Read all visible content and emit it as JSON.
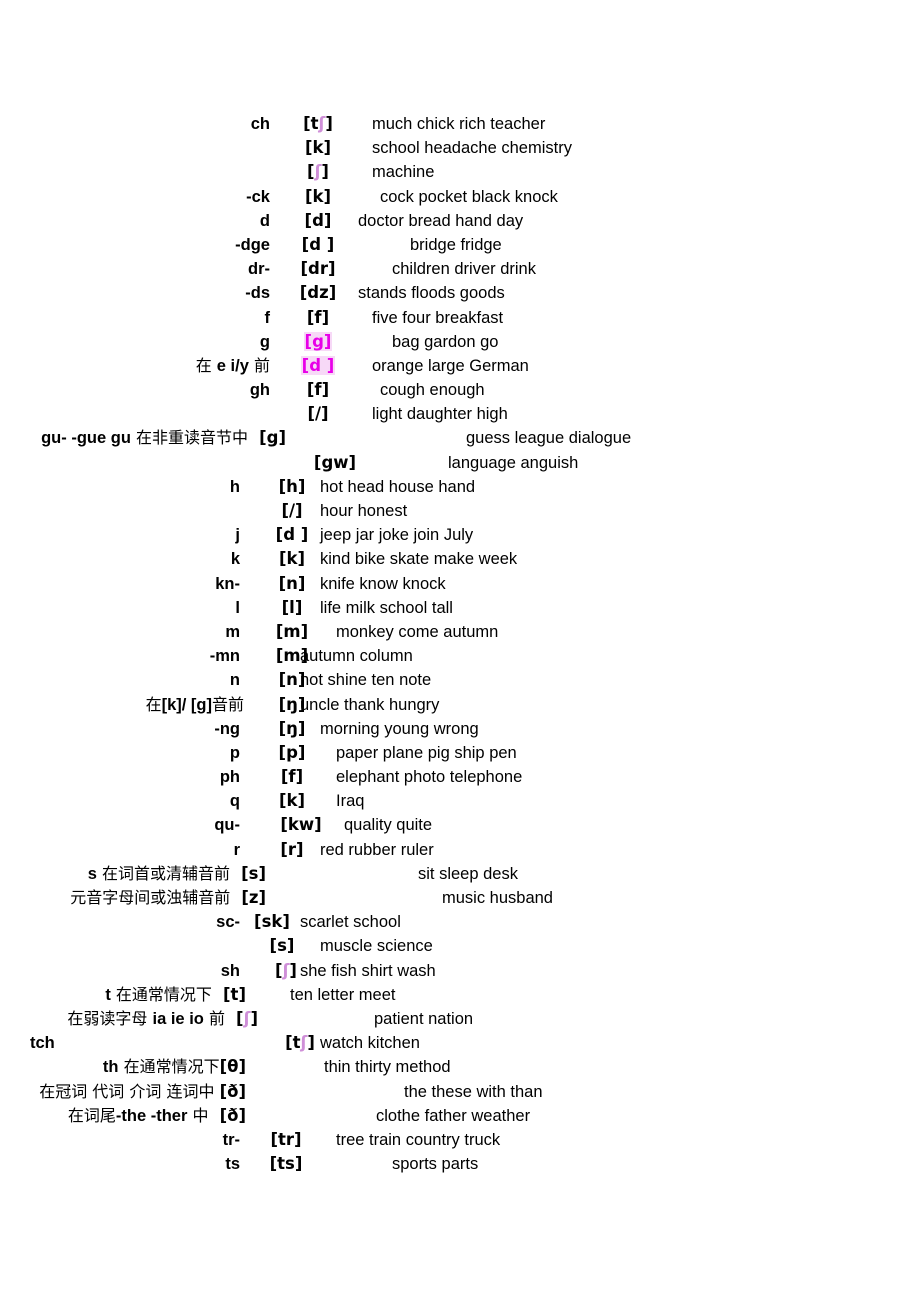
{
  "document": {
    "type": "english-pronunciation-rules-table",
    "page_background": "#ffffff",
    "highlight_color": "#e800e8",
    "highlight_background": "#f7d9f7",
    "faint_symbol_color": "#cf8fd8"
  },
  "rows": [
    {
      "letter": "ch",
      "symbol": "[tʃ]",
      "symbol_style": "faint-tail",
      "words": "much     chick    rich        teacher"
    },
    {
      "letter": "",
      "symbol": "[k]",
      "words": "school     headache    chemistry"
    },
    {
      "letter": "",
      "symbol": "[ʃ]",
      "symbol_style": "faint",
      "words": "machine"
    },
    {
      "letter": "-ck",
      "symbol": "[k]",
      "words": "cock     pocket      black      knock"
    },
    {
      "letter": "d",
      "symbol": "[d]",
      "words": "doctor    bread      hand      day"
    },
    {
      "letter": "-dge",
      "symbol": "[d  ]",
      "words": "bridge     fridge"
    },
    {
      "letter": "dr-",
      "symbol": "[dr]",
      "words": "children     driver     drink"
    },
    {
      "letter": "-ds",
      "symbol": "[dz]",
      "words": "stands    floods   goods"
    },
    {
      "letter": "f",
      "symbol": "[f]",
      "words": "five      four     breakfast"
    },
    {
      "letter": "g",
      "symbol": "[g]",
      "symbol_style": "highlight",
      "words": "bag     gardon     go"
    },
    {
      "letter": "在 e i/y 前",
      "letter_style": "rule-mixed",
      "symbol": "[d ]",
      "symbol_style": "highlight",
      "words": "orange    large    German"
    },
    {
      "letter": "gh",
      "symbol": "[f]",
      "words": "cough     enough"
    },
    {
      "letter": "",
      "symbol": "[/]",
      "words": "light     daughter       high"
    },
    {
      "letter": "gu- -gue gu 在非重读音节中",
      "letter_style": "rule-long",
      "symbol": "[g]",
      "symbol_inline": true,
      "words": "guess     league      dialogue"
    },
    {
      "letter": "",
      "symbol": "[gw]",
      "words": "language    anguish"
    },
    {
      "letter": "h",
      "symbol": "[h]",
      "words": "hot    head   house     hand"
    },
    {
      "letter": "",
      "symbol": "[/]",
      "words": "hour   honest"
    },
    {
      "letter": "j",
      "symbol": "[d ]",
      "words": "jeep   jar   joke   join    July"
    },
    {
      "letter": "k",
      "symbol": "[k]",
      "words": "kind    bike    skate    make     week"
    },
    {
      "letter": "kn-",
      "symbol": "[n]",
      "words": "knife    know    knock"
    },
    {
      "letter": "l",
      "symbol": "[l]",
      "words": "life    milk    school    tall"
    },
    {
      "letter": "m",
      "symbol": "[m]",
      "words": "monkey    come    autumn"
    },
    {
      "letter": "-mn",
      "symbol": "[m]",
      "words": "autumn    column"
    },
    {
      "letter": "n",
      "symbol": "[n]",
      "words": "not  shine    ten    note"
    },
    {
      "letter": "在[k]/ [g]音前",
      "letter_style": "rule-left",
      "symbol": "[ŋ]",
      "words": "uncle    thank    hungry"
    },
    {
      "letter": "-ng",
      "symbol": "[ŋ]",
      "words": "morning   young    wrong"
    },
    {
      "letter": "p",
      "symbol": "[p]",
      "words": "paper    plane    pig   ship   pen"
    },
    {
      "letter": "ph",
      "symbol": "[f]",
      "words": "elephant    photo   telephone"
    },
    {
      "letter": "q",
      "symbol": "[k]",
      "words": "Iraq"
    },
    {
      "letter": "qu-",
      "symbol": "[kw]",
      "words": "quality    quite"
    },
    {
      "letter": "r",
      "symbol": "[r]",
      "words": "red    rubber    ruler"
    },
    {
      "letter": "s 在词首或清辅音前",
      "letter_style": "rule-mixed",
      "symbol": "[s]",
      "symbol_inline": true,
      "words": "sit     sleep     desk"
    },
    {
      "letter": "元音字母间或浊辅音前",
      "letter_style": "rule-zh",
      "symbol": "[z]",
      "symbol_inline": true,
      "words": "music      husband"
    },
    {
      "letter": "sc-",
      "symbol": "[sk]",
      "words": "scarlet   school"
    },
    {
      "letter": "",
      "symbol": "[s]",
      "words": "muscle      science"
    },
    {
      "letter": "sh",
      "symbol": "[ʃ]",
      "words": "she     fish    shirt   wash"
    },
    {
      "letter": "t 在通常情况下",
      "letter_style": "rule-mixed",
      "symbol": "[t]",
      "symbol_inline": true,
      "words": "ten letter meet"
    },
    {
      "letter": "在弱读字母 ia ie io 前",
      "letter_style": "rule-mixed",
      "symbol": "[ʃ]",
      "symbol_inline": true,
      "words": "patient      nation"
    },
    {
      "letter": "tch",
      "symbol": "[tʃ]",
      "words": "watch   kitchen"
    },
    {
      "letter": "th 在通常情况下",
      "letter_style": "rule-mixed",
      "symbol": "[θ]",
      "symbol_inline": true,
      "words": "thin     thirty     method"
    },
    {
      "letter": "在冠词 代词 介词 连词中",
      "letter_style": "rule-zh",
      "symbol": "[ð]",
      "symbol_inline": true,
      "words": "the these with than"
    },
    {
      "letter": "在词尾-the -ther 中",
      "letter_style": "rule-mixed",
      "symbol": "[ð]",
      "symbol_inline": true,
      "words": "clothe father weather"
    },
    {
      "letter": "tr-",
      "symbol": "[tr]",
      "words": "tree    train    country     truck"
    },
    {
      "letter": "ts",
      "symbol": "[ts]",
      "words": "sports    parts"
    }
  ]
}
